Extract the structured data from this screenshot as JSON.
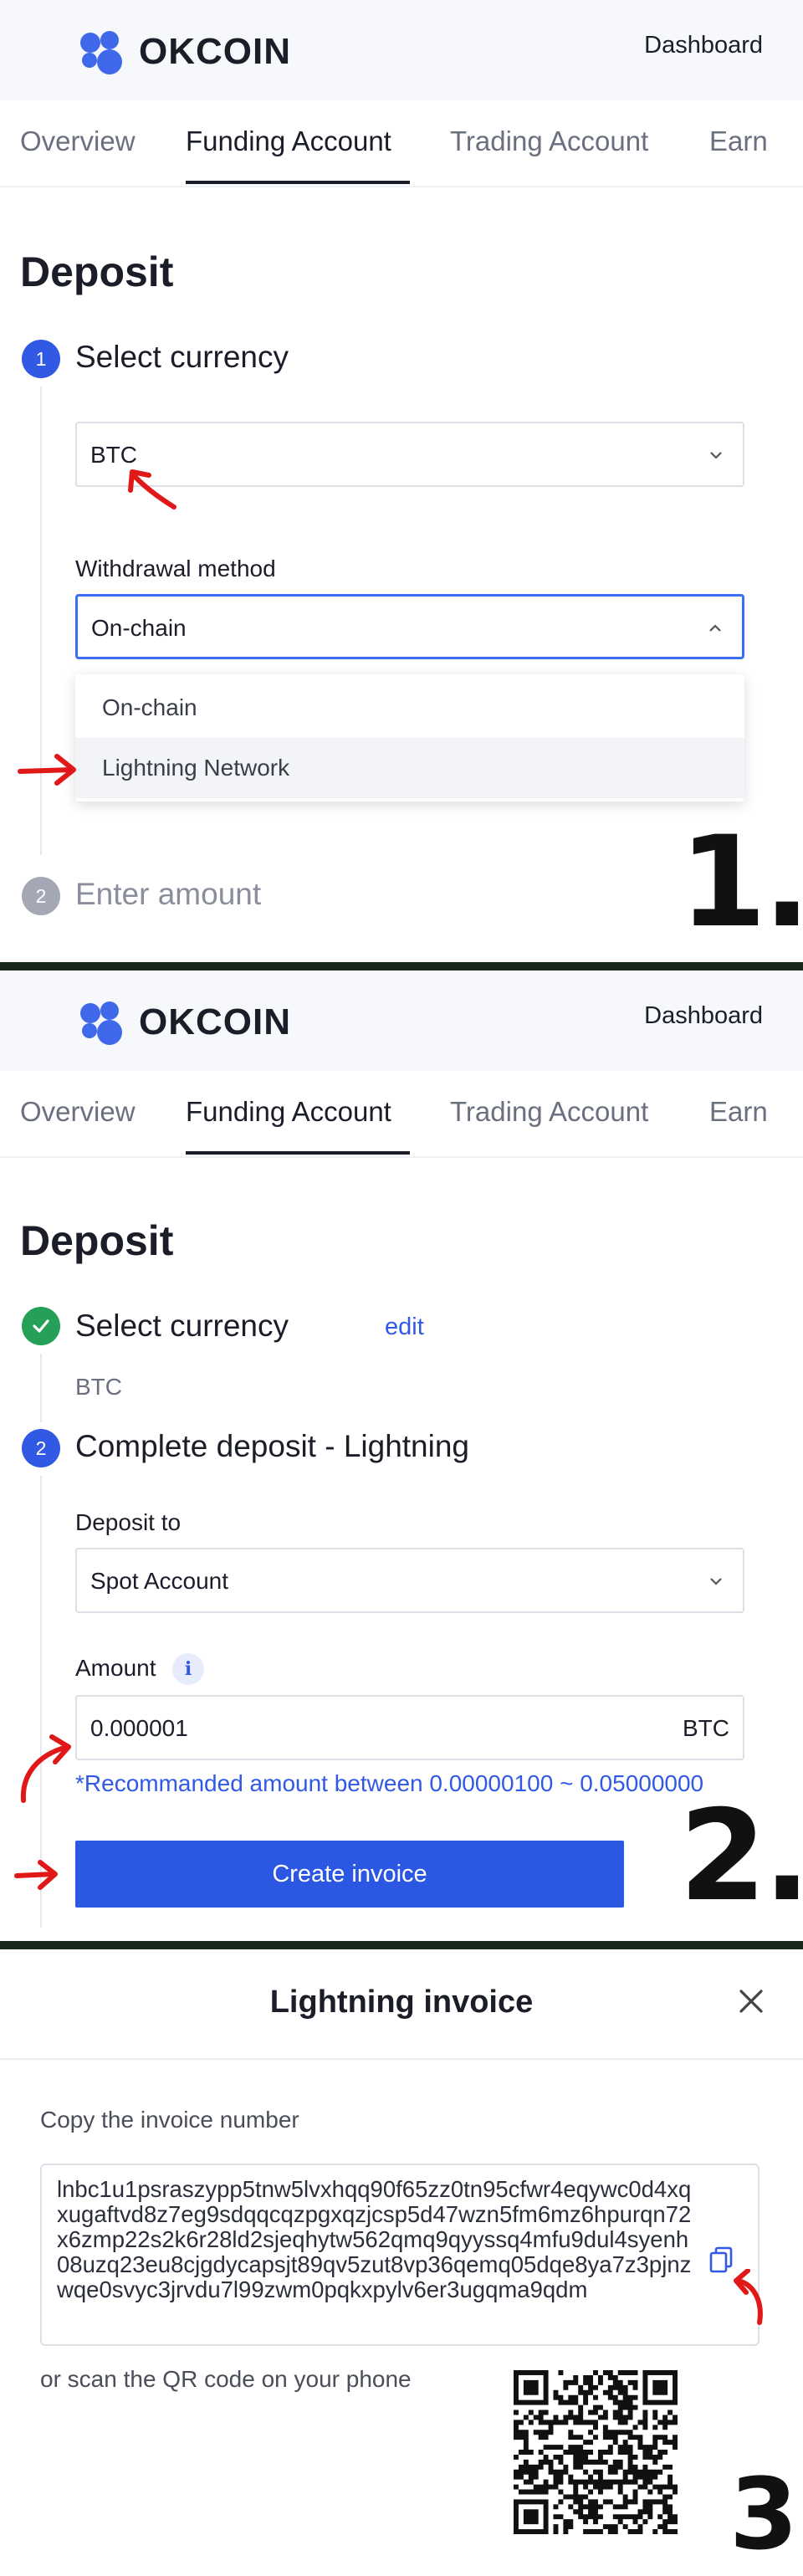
{
  "header": {
    "logo_text": "OKCOIN",
    "dashboard_link": "Dashboard"
  },
  "tabs": [
    {
      "label": "Overview"
    },
    {
      "label": "Funding Account"
    },
    {
      "label": "Trading Account"
    },
    {
      "label": "Earn"
    }
  ],
  "screen1": {
    "title": "Deposit",
    "step1": {
      "number": "1",
      "title": "Select currency"
    },
    "currency_value": "BTC",
    "method_label": "Withdrawal method",
    "method_value": "On-chain",
    "method_options": [
      {
        "label": "On-chain"
      },
      {
        "label": "Lightning Network"
      }
    ],
    "step2": {
      "number": "2",
      "title": "Enter amount"
    },
    "marker": "1."
  },
  "screen2": {
    "title": "Deposit",
    "step1_title": "Select currency",
    "edit_label": "edit",
    "currency_value": "BTC",
    "step2": {
      "number": "2",
      "title": "Complete deposit - Lightning"
    },
    "deposit_to_label": "Deposit to",
    "deposit_to_value": "Spot Account",
    "amount_label": "Amount",
    "amount_info": "i",
    "amount_value": "0.000001",
    "amount_unit": "BTC",
    "hint": "*Recommanded amount between 0.00000100 ~ 0.05000000",
    "create_button": "Create invoice",
    "marker": "2."
  },
  "screen3": {
    "title": "Lightning invoice",
    "copy_label": "Copy the invoice number",
    "invoice": "lnbc1u1psraszypp5tnw5lvxhqq90f65zz0tn95cfwr4eqywc0d4xqxugaftvd8z7eg9sdqqcqzpgxqzjcsp5d47wzn5fm6mz6hpurqn72x6zmp22s2k6r28ld2sjeqhytw562qmq9qyyssq4mfu9dul4syenh08uzq23eu8cjgdycapsjt89qv5zut8vp36qemq05dqe8ya7z3pjnzwqe0svyc3jrvdu7l99zwm0pqkxpylv6er3ugqma9qdm",
    "scan_label": "or scan the QR code on your phone",
    "marker": "3."
  },
  "colors": {
    "brand_blue": "#3159e4",
    "annotation_red": "#e01818",
    "success_green": "#24a058"
  },
  "icons": [
    "logo-mark-icon",
    "chevron-down-icon",
    "chevron-up-icon",
    "check-icon",
    "info-icon",
    "close-icon",
    "copy-icon",
    "qr-code-icon",
    "red-arrow-annotation-icon"
  ]
}
